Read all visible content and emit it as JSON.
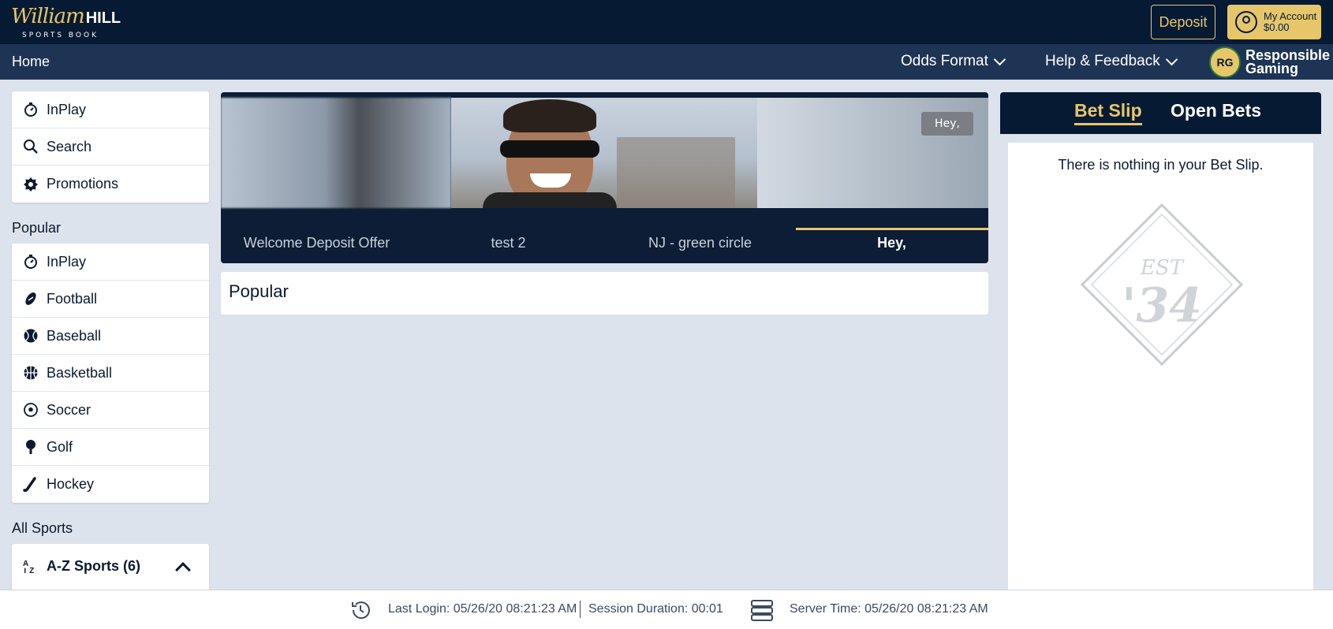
{
  "brand": {
    "script": "William",
    "bold": "HILL",
    "sub": "SPORTS BOOK"
  },
  "header": {
    "deposit_label": "Deposit",
    "account_label": "My Account",
    "balance": "$0.00"
  },
  "nav": {
    "home": "Home",
    "odds_format": "Odds Format",
    "help": "Help & Feedback",
    "rg_badge": "RG",
    "rg_line1": "Responsible",
    "rg_line2": "Gaming"
  },
  "sidebar": {
    "top_items": [
      {
        "label": "InPlay",
        "icon": "stopwatch-icon"
      },
      {
        "label": "Search",
        "icon": "search-icon"
      },
      {
        "label": "Promotions",
        "icon": "badge-icon"
      }
    ],
    "popular_title": "Popular",
    "popular_items": [
      {
        "label": "InPlay",
        "icon": "stopwatch-icon"
      },
      {
        "label": "Football",
        "icon": "football-icon"
      },
      {
        "label": "Baseball",
        "icon": "baseball-icon"
      },
      {
        "label": "Basketball",
        "icon": "basketball-icon"
      },
      {
        "label": "Soccer",
        "icon": "soccer-ball-icon"
      },
      {
        "label": "Golf",
        "icon": "golf-icon"
      },
      {
        "label": "Hockey",
        "icon": "hockey-icon"
      }
    ],
    "all_sports_title": "All Sports",
    "az_label": "A-Z Sports (6)"
  },
  "banner": {
    "tag": "Hey,",
    "tabs": [
      {
        "label": "Welcome Deposit Offer",
        "active": false
      },
      {
        "label": "test 2",
        "active": false
      },
      {
        "label": "NJ - green circle",
        "active": false
      },
      {
        "label": "Hey,",
        "active": true
      }
    ]
  },
  "main": {
    "popular_heading": "Popular"
  },
  "betslip": {
    "tab_active": "Bet Slip",
    "tab_other": "Open Bets",
    "empty_message": "There is nothing in your Bet Slip.",
    "seal_top": "EST",
    "seal_year": "'34"
  },
  "footer": {
    "last_login": "Last Login: 05/26/20 08:21:23 AM",
    "session": "Session Duration: 00:01",
    "server_time": "Server Time: 05/26/20 08:21:23 AM"
  },
  "colors": {
    "navy": "#071a33",
    "nav": "#1d3454",
    "gold": "#e7c66a",
    "background": "#dde3ec"
  }
}
